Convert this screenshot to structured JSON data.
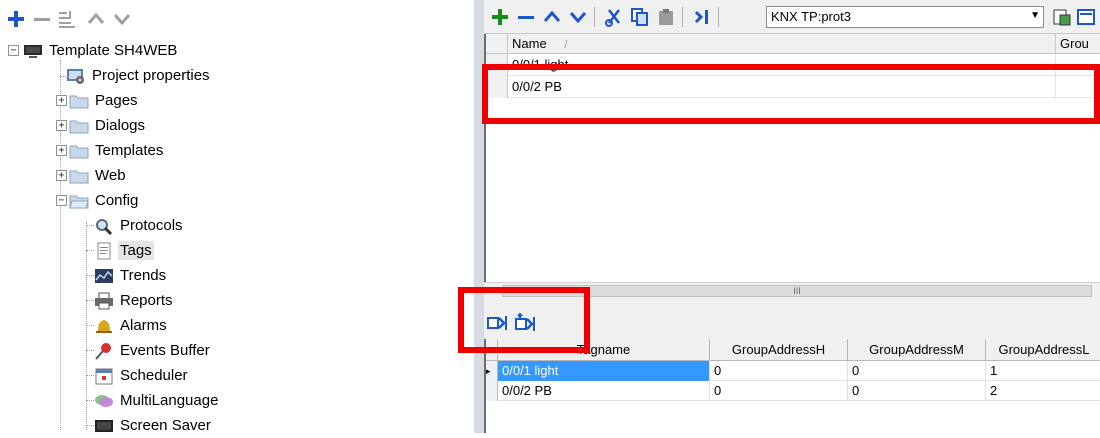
{
  "left_toolbar": {
    "buttons": [
      {
        "name": "add",
        "glyph": "+"
      },
      {
        "name": "remove",
        "glyph": "–"
      },
      {
        "name": "properties",
        "glyph": "≣"
      },
      {
        "name": "move-up",
        "glyph": "∧"
      },
      {
        "name": "move-down",
        "glyph": "∨"
      }
    ]
  },
  "tree": {
    "root": "Template SH4WEB",
    "items": [
      {
        "label": "Project properties"
      },
      {
        "label": "Pages"
      },
      {
        "label": "Dialogs"
      },
      {
        "label": "Templates"
      },
      {
        "label": "Web"
      },
      {
        "label": "Config"
      },
      {
        "label": "Protocols"
      },
      {
        "label": "Tags"
      },
      {
        "label": "Trends"
      },
      {
        "label": "Reports"
      },
      {
        "label": "Alarms"
      },
      {
        "label": "Events Buffer"
      },
      {
        "label": "Scheduler"
      },
      {
        "label": "MultiLanguage"
      },
      {
        "label": "Screen Saver"
      }
    ],
    "selected": "Tags"
  },
  "right_toolbar": {
    "protocol_value": "KNX TP:prot3"
  },
  "top_grid": {
    "headers": [
      "Name",
      "Grou"
    ],
    "sort_indicator": "/",
    "rows": [
      {
        "name": "0/0/1 light"
      },
      {
        "name": "0/0/2 PB"
      }
    ]
  },
  "hscroll": {
    "thumb_label": "III"
  },
  "bottom_grid": {
    "headers": [
      "Tagname",
      "GroupAddressH",
      "GroupAddressM",
      "GroupAddressL"
    ],
    "rows": [
      {
        "tagname": "0/0/1 light",
        "h": "0",
        "m": "0",
        "l": "1"
      },
      {
        "tagname": "0/0/2 PB",
        "h": "0",
        "m": "0",
        "l": "2"
      }
    ]
  },
  "colors": {
    "accent_blue": "#1f56c7",
    "highlight_red": "#ee0000",
    "add_green": "#1a8a1a",
    "selection_blue": "#3399ff"
  }
}
